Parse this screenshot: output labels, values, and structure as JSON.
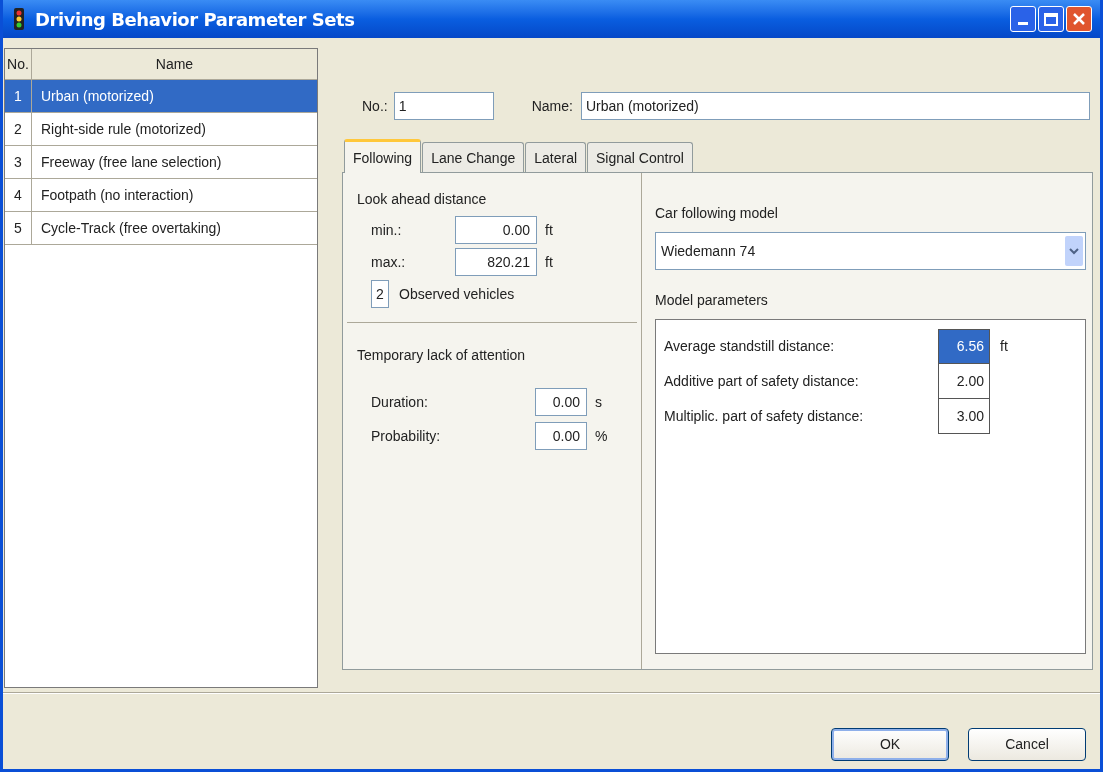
{
  "window": {
    "title": "Driving Behavior Parameter Sets"
  },
  "list": {
    "columns": [
      "No.",
      "Name"
    ],
    "rows": [
      {
        "no": "1",
        "name": "Urban (motorized)",
        "selected": true
      },
      {
        "no": "2",
        "name": "Right-side rule (motorized)",
        "selected": false
      },
      {
        "no": "3",
        "name": "Freeway (free lane selection)",
        "selected": false
      },
      {
        "no": "4",
        "name": "Footpath (no interaction)",
        "selected": false
      },
      {
        "no": "5",
        "name": "Cycle-Track (free overtaking)",
        "selected": false
      }
    ]
  },
  "no_field": {
    "label": "No.:",
    "value": "1"
  },
  "name_field": {
    "label": "Name:",
    "value": "Urban (motorized)"
  },
  "tabs": [
    {
      "label": "Following",
      "selected": true
    },
    {
      "label": "Lane Change",
      "selected": false
    },
    {
      "label": "Lateral",
      "selected": false
    },
    {
      "label": "Signal Control",
      "selected": false
    }
  ],
  "look_ahead": {
    "title": "Look ahead distance",
    "fields": [
      {
        "label": "min.:",
        "value": "0.00",
        "unit": "ft"
      },
      {
        "label": "max.:",
        "value": "820.21",
        "unit": "ft"
      }
    ],
    "observed": {
      "value": "2",
      "label": "Observed vehicles"
    }
  },
  "attention": {
    "title": "Temporary lack of attention",
    "fields": [
      {
        "label": "Duration:",
        "value": "0.00",
        "unit": "s"
      },
      {
        "label": "Probability:",
        "value": "0.00",
        "unit": "%"
      }
    ]
  },
  "car_following": {
    "label": "Car following model",
    "value": "Wiedemann 74"
  },
  "model_parameters": {
    "title": "Model parameters",
    "rows": [
      {
        "label": "Average standstill distance:",
        "value": "6.56",
        "unit": "ft",
        "selected": true
      },
      {
        "label": "Additive part of safety distance:",
        "value": "2.00",
        "selected": false
      },
      {
        "label": "Multiplic. part of safety distance:",
        "value": "3.00",
        "selected": false
      }
    ]
  },
  "buttons": [
    {
      "label": "OK",
      "default": true
    },
    {
      "label": "Cancel",
      "default": false
    }
  ]
}
